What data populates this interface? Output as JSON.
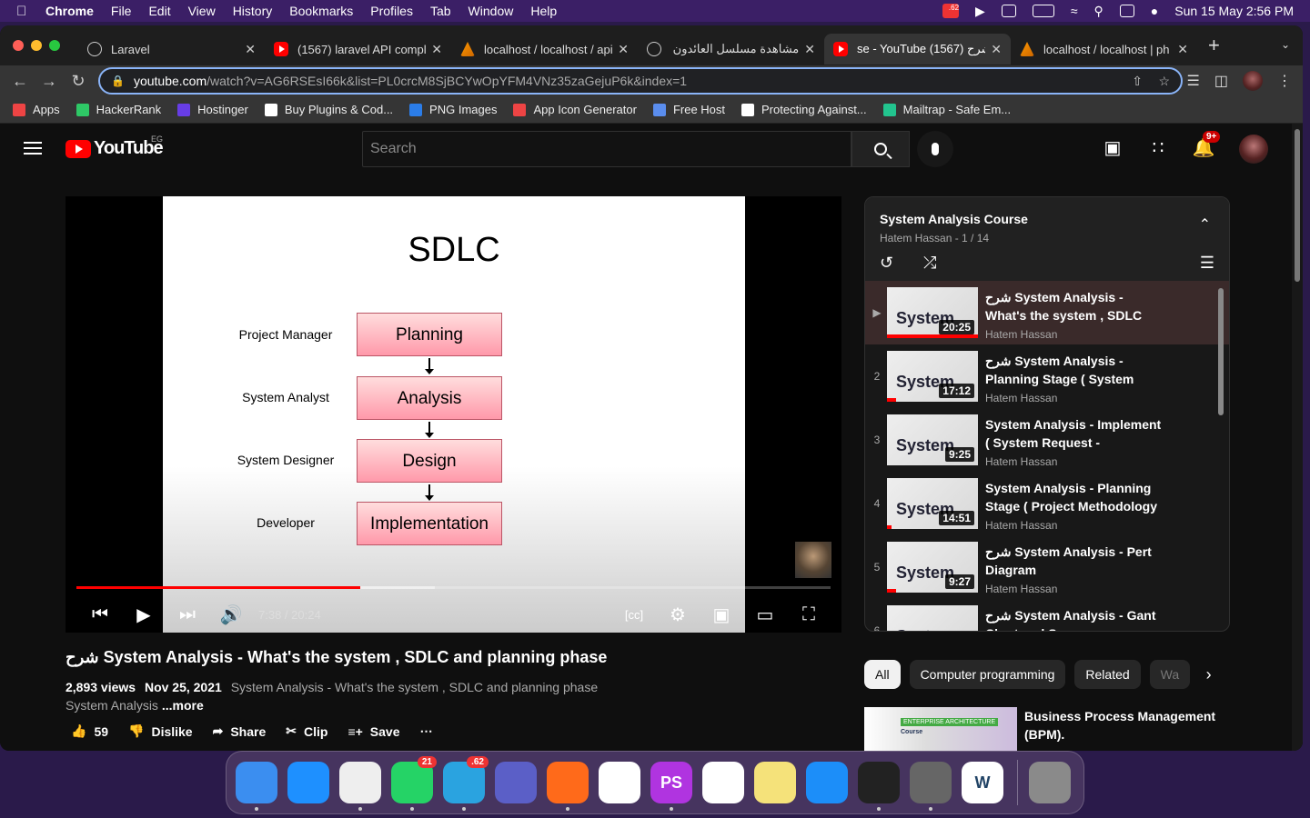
{
  "menubar": {
    "app": "Chrome",
    "items": [
      "File",
      "Edit",
      "View",
      "History",
      "Bookmarks",
      "Profiles",
      "Tab",
      "Window",
      "Help"
    ],
    "badge": ".62",
    "datetime": "Sun 15 May  2:56 PM"
  },
  "tabs": [
    {
      "title": "Laravel",
      "favicon": "globe-icon"
    },
    {
      "title": "(1567) laravel API compl",
      "favicon": "youtube-icon"
    },
    {
      "title": "localhost / localhost / api",
      "favicon": "phpmyadmin-icon"
    },
    {
      "title": "مشاهدة مسلسل العائدون - ال",
      "favicon": "globe-icon"
    },
    {
      "title": "se - YouTube شرح (1567)",
      "favicon": "youtube-icon",
      "active": true
    },
    {
      "title": "localhost / localhost | ph",
      "favicon": "phpmyadmin-icon"
    }
  ],
  "omnibox": {
    "host": "youtube.com",
    "path": "/watch?v=AG6RSEsI66k&list=PL0crcM8SjBCYwOpYFM4VNz35zaGejuP6k&index=1"
  },
  "bookmarks": [
    {
      "label": "Apps",
      "color": "#e44"
    },
    {
      "label": "HackerRank",
      "color": "#2ec866"
    },
    {
      "label": "Hostinger",
      "color": "#673de6"
    },
    {
      "label": "Buy Plugins & Cod...",
      "color": "#ffffff"
    },
    {
      "label": "PNG Images",
      "color": "#2b7de9"
    },
    {
      "label": "App Icon Generator",
      "color": "#e44"
    },
    {
      "label": "Free Host",
      "color": "#5a8dee"
    },
    {
      "label": "Protecting Against...",
      "color": "#ffffff"
    },
    {
      "label": "Mailtrap - Safe Em...",
      "color": "#22c48e"
    }
  ],
  "yt": {
    "logo": "YouTube",
    "country": "EG",
    "search_placeholder": "Search",
    "notif_badge": "9+"
  },
  "slide": {
    "title": "SDLC",
    "roles": [
      "Project Manager",
      "System Analyst",
      "System Designer",
      "Developer"
    ],
    "phases": [
      "Planning",
      "Analysis",
      "Design",
      "Implementation"
    ]
  },
  "player": {
    "time": "7:38 / 20:24",
    "played_fraction": 0.376,
    "buffered_fraction": 0.475
  },
  "video": {
    "title": "شرح System Analysis - What's the system , SDLC and planning phase",
    "views": "2,893 views",
    "date": "Nov 25, 2021",
    "desc_line1": "System Analysis - What's the system , SDLC and planning phase",
    "desc_line2": "System Analysis",
    "more": "...more",
    "likes": "59",
    "dislike": "Dislike",
    "share": "Share",
    "clip": "Clip",
    "save": "Save"
  },
  "playlist": {
    "title": "System Analysis Course",
    "sub": "Hatem Hassan - 1 / 14",
    "items": [
      {
        "idx": "▶",
        "title": "شرح System Analysis - What's the system , SDLC and…",
        "channel": "Hatem Hassan",
        "duration": "20:25",
        "watched": 1.0
      },
      {
        "idx": "2",
        "title": "شرح System Analysis - Planning Stage ( System Request -…",
        "channel": "Hatem Hassan",
        "duration": "17:12",
        "watched": 0.1
      },
      {
        "idx": "3",
        "title": "System Analysis - Implement ( System Request - Feasibility…",
        "channel": "Hatem Hassan",
        "duration": "9:25",
        "watched": 0
      },
      {
        "idx": "4",
        "title": "System Analysis - Planning Stage ( Project Methodology …",
        "channel": "Hatem Hassan",
        "duration": "14:51",
        "watched": 0.05
      },
      {
        "idx": "5",
        "title": "شرح System Analysis - Pert Diagram",
        "channel": "Hatem Hassan",
        "duration": "9:27",
        "watched": 0.1
      },
      {
        "idx": "6",
        "title": "شرح System Analysis - Gant Chart and Scope Management",
        "channel": "Hatem Hassan",
        "duration": "",
        "watched": 0
      }
    ]
  },
  "chips": [
    "All",
    "Computer programming",
    "Related",
    "Wa"
  ],
  "rec": {
    "title": "Business Process Management (BPM).",
    "thumb_text1": "ENTERPRISE ARCHITECTURE",
    "thumb_text2": "Course"
  },
  "dock": [
    {
      "name": "finder-icon",
      "color": "#3b8ef0"
    },
    {
      "name": "safari-icon",
      "color": "#1e90ff"
    },
    {
      "name": "chrome-icon",
      "color": "#eeeeee"
    },
    {
      "name": "whatsapp-icon",
      "color": "#25d366",
      "badge": "21"
    },
    {
      "name": "telegram-icon",
      "color": "#2aa3e0",
      "badge": ".62"
    },
    {
      "name": "teams-icon",
      "color": "#5b5fc7"
    },
    {
      "name": "pencil-icon",
      "color": "#ff6a1a"
    },
    {
      "name": "vscode-icon",
      "color": "#ffffff"
    },
    {
      "name": "phpstorm-icon",
      "color": "#b034e0",
      "label": "PS"
    },
    {
      "name": "appstore-a-icon",
      "color": "#ffffff"
    },
    {
      "name": "notes-icon",
      "color": "#f5e27a"
    },
    {
      "name": "app-store-icon",
      "color": "#1c8ef9"
    },
    {
      "name": "terminal-icon",
      "color": "#222222"
    },
    {
      "name": "tableplus-icon",
      "color": "#666666"
    },
    {
      "name": "word-icon",
      "color": "#ffffff",
      "label": "W"
    },
    {
      "name": "trash-icon",
      "color": "#8a8a8a"
    }
  ]
}
